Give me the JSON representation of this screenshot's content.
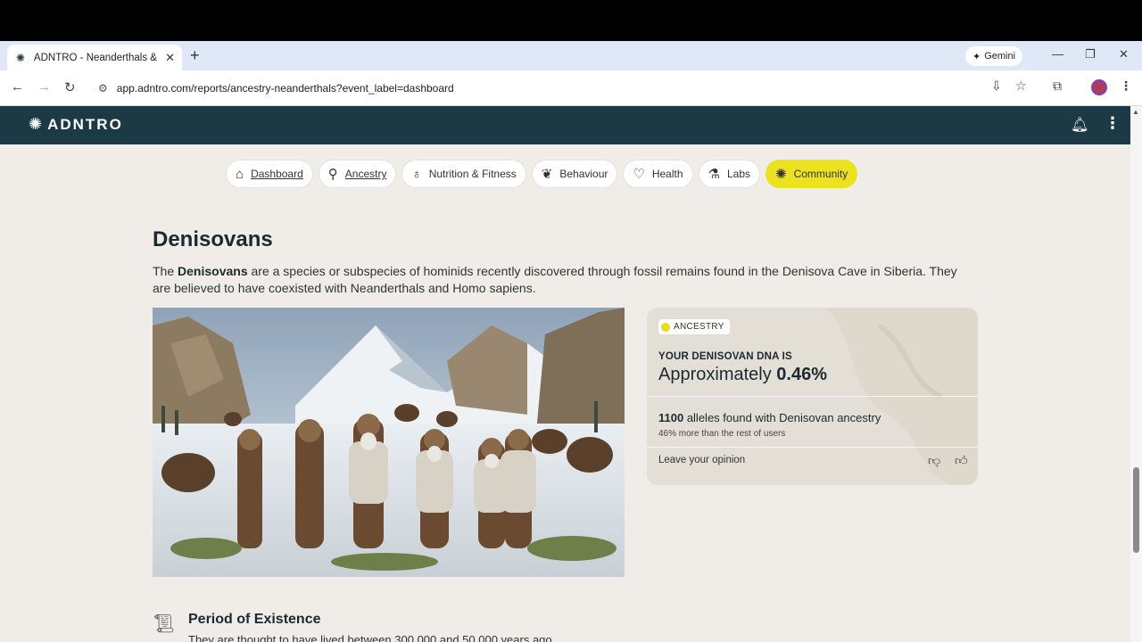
{
  "browser": {
    "tab_title": "ADNTRO - Neanderthals & Den",
    "new_tab": "+",
    "gemini_label": "Gemini",
    "url": "app.adntro.com/reports/ancestry-neanderthals?event_label=dashboard"
  },
  "app": {
    "brand": "ADNTRO"
  },
  "nav": [
    {
      "label": "Dashboard",
      "icon": "home-icon"
    },
    {
      "label": "Ancestry",
      "icon": "ancestry-icon"
    },
    {
      "label": "Nutrition & Fitness",
      "icon": "apple-icon"
    },
    {
      "label": "Behaviour",
      "icon": "brain-icon"
    },
    {
      "label": "Health",
      "icon": "heart-pulse-icon"
    },
    {
      "label": "Labs",
      "icon": "flask-icon"
    },
    {
      "label": "Community",
      "icon": "community-icon"
    }
  ],
  "section": {
    "title": "Denisovans",
    "intro_pre": "The ",
    "intro_bold": "Denisovans",
    "intro_post": " are a species or subspecies of hominids recently discovered through fossil remains found in the Denisova Cave in Siberia. They are believed to have coexisted with Neanderthals and Homo sapiens."
  },
  "card": {
    "badge": "ANCESTRY",
    "dna_label": "YOUR DENISOVAN DNA IS",
    "dna_prefix": "Approximately ",
    "dna_value": "0.46%",
    "alleles_count": "1100",
    "alleles_text": " alleles found with Denisovan ancestry",
    "alleles_sub": "46% more than the rest of users",
    "opinion": "Leave your opinion"
  },
  "period": {
    "title": "Period of Existence",
    "text": "They are thought to have lived between 300,000 and 50,000 years ago"
  },
  "colors": {
    "appbar": "#1c3a45",
    "page_bg": "#f0ece8",
    "accent": "#ece21d"
  }
}
